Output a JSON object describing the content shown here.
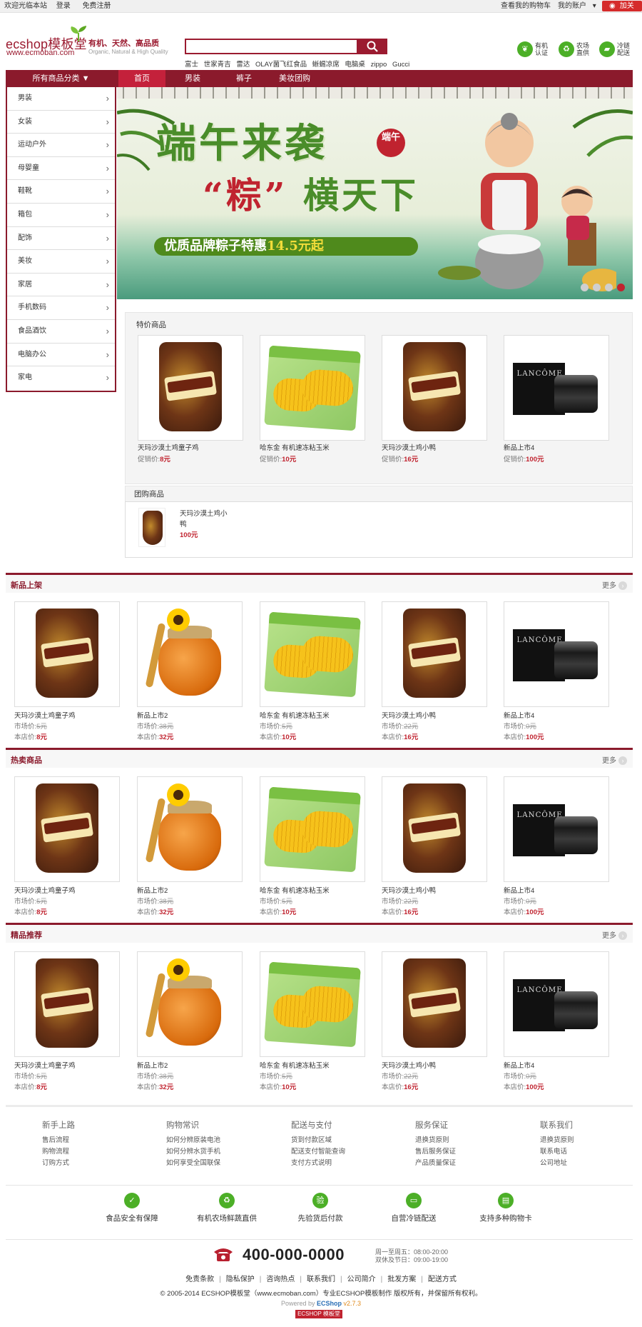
{
  "topbar": {
    "welcome": "欢迎光临本站",
    "login": "登录",
    "register": "免费注册",
    "cart_link": "查看我的购物车",
    "account": "我的账户",
    "follow": "加关注"
  },
  "header": {
    "logo_text": "ecshop模板堂",
    "logo_url": "www.ecmoban.com",
    "slogan": "有机、天然、高品质",
    "slogan_en": "Organic, Natural & High Quality",
    "search_placeholder": "",
    "hot_keywords": [
      "富士",
      "世家青吉",
      "雷达",
      "OLAY菌飞红食品",
      "蜥蜴凉席",
      "电脑桌",
      "zippo",
      "Gucci"
    ],
    "badges": [
      {
        "label": "有机\n认证",
        "icon": "leaf-icon"
      },
      {
        "label": "农场\n直供",
        "icon": "recycle-icon"
      },
      {
        "label": "冷链\n配送",
        "icon": "truck-icon"
      }
    ]
  },
  "nav": {
    "all_categories": "所有商品分类 ▼",
    "items": [
      "首页",
      "男装",
      "裤子",
      "美妆团购"
    ]
  },
  "categories": [
    "男装",
    "女装",
    "运动户外",
    "母婴童",
    "鞋靴",
    "箱包",
    "配饰",
    "美妆",
    "家居",
    "手机数码",
    "食品酒饮",
    "电脑办公",
    "家电"
  ],
  "banner": {
    "title_line1": "端午来袭",
    "title_line2_quote": "“粽”",
    "title_line2_rest": "横天下",
    "subtitle_pre": "优质品牌粽子特惠",
    "subtitle_price": "14.5元起",
    "seal": "端午"
  },
  "sale": {
    "title": "特价商品",
    "price_label": "促销价:",
    "items": [
      {
        "name": "天玛沙漠土鸡童子鸡",
        "price": "8元",
        "art": "bag"
      },
      {
        "name": "哈东金 有机速冻粘玉米",
        "price": "10元",
        "art": "corn"
      },
      {
        "name": "天玛沙漠土鸡小鸭",
        "price": "16元",
        "art": "bag"
      },
      {
        "name": "新品上市4",
        "price": "100元",
        "art": "lancome"
      }
    ]
  },
  "group": {
    "title": "团购商品",
    "item_name_1": "天玛沙漠土鸡小",
    "item_name_2": "鸭",
    "item_price": "100元"
  },
  "sections": [
    {
      "title": "新品上架",
      "more": "更多",
      "items": [
        {
          "name": "天玛沙漠土鸡童子鸡",
          "market": "5元",
          "price": "8元",
          "art": "bag"
        },
        {
          "name": "新品上市2",
          "market": "38元",
          "price": "32元",
          "art": "honey"
        },
        {
          "name": "哈东金 有机速冻粘玉米",
          "market": "5元",
          "price": "10元",
          "art": "corn"
        },
        {
          "name": "天玛沙漠土鸡小鸭",
          "market": "22元",
          "price": "16元",
          "art": "bag"
        },
        {
          "name": "新品上市4",
          "market": "0元",
          "price": "100元",
          "art": "lancome"
        }
      ]
    },
    {
      "title": "热卖商品",
      "more": "更多",
      "items": [
        {
          "name": "天玛沙漠土鸡童子鸡",
          "market": "5元",
          "price": "8元",
          "art": "bag"
        },
        {
          "name": "新品上市2",
          "market": "38元",
          "price": "32元",
          "art": "honey"
        },
        {
          "name": "哈东金 有机速冻粘玉米",
          "market": "5元",
          "price": "10元",
          "art": "corn"
        },
        {
          "name": "天玛沙漠土鸡小鸭",
          "market": "22元",
          "price": "16元",
          "art": "bag"
        },
        {
          "name": "新品上市4",
          "market": "0元",
          "price": "100元",
          "art": "lancome"
        }
      ]
    },
    {
      "title": "精品推荐",
      "more": "更多",
      "items": [
        {
          "name": "天玛沙漠土鸡童子鸡",
          "market": "5元",
          "price": "8元",
          "art": "bag"
        },
        {
          "name": "新品上市2",
          "market": "38元",
          "price": "32元",
          "art": "honey"
        },
        {
          "name": "哈东金 有机速冻粘玉米",
          "market": "5元",
          "price": "10元",
          "art": "corn"
        },
        {
          "name": "天玛沙漠土鸡小鸭",
          "market": "22元",
          "price": "16元",
          "art": "bag"
        },
        {
          "name": "新品上市4",
          "market": "0元",
          "price": "100元",
          "art": "lancome"
        }
      ]
    }
  ],
  "labels": {
    "market_price": "市场价:",
    "shop_price": "本店价:"
  },
  "footer": {
    "columns": [
      {
        "title": "新手上路",
        "links": [
          "售后流程",
          "购物流程",
          "订购方式"
        ]
      },
      {
        "title": "购物常识",
        "links": [
          "如何分辨原装电池",
          "如何分辨水货手机",
          "如何享受全国联保"
        ]
      },
      {
        "title": "配送与支付",
        "links": [
          "货到付款区域",
          "配送支付智能查询",
          "支付方式说明"
        ]
      },
      {
        "title": "服务保证",
        "links": [
          "退换货原则",
          "售后服务保证",
          "产品质量保证"
        ]
      },
      {
        "title": "联系我们",
        "links": [
          "退换货原则",
          "联系电话",
          "公司地址"
        ]
      }
    ],
    "services": [
      {
        "label": "食品安全有保障",
        "icon": "shield-icon",
        "glyph": "✓"
      },
      {
        "label": "有机农场鲜蔬直供",
        "icon": "recycle-icon",
        "glyph": "♻"
      },
      {
        "label": "先验货后付款",
        "icon": "inspect-icon",
        "glyph": "验"
      },
      {
        "label": "自营冷链配送",
        "icon": "truck-icon",
        "glyph": "▭"
      },
      {
        "label": "支持多种购物卡",
        "icon": "card-icon",
        "glyph": "▤"
      }
    ],
    "phone": "400-000-0000",
    "hours_1": "周一至周五：08:00-20:00",
    "hours_2": "双休及节日：09:00-19:00",
    "bottom_links": [
      "免责条款",
      "隐私保护",
      "咨询热点",
      "联系我们",
      "公司简介",
      "批发方案",
      "配送方式"
    ],
    "copyright": "© 2005-2014 ECSHOP模板堂（www.ecmoban.com）专业ECSHOP模板制作 版权所有，并保留所有权利。",
    "powered_pre": "Powered by",
    "powered_brand": "ECShop",
    "powered_version": "v2.7.3",
    "bottom_logo": "ECSHOP 模板堂"
  },
  "colors": {
    "brand": "#8b1a2c",
    "accent": "#c0232f",
    "green": "#4caf27"
  }
}
